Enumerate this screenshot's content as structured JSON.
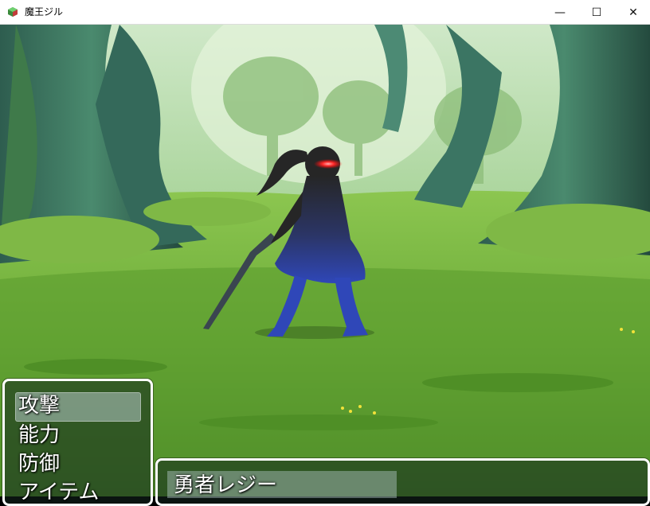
{
  "window": {
    "title": "魔王ジル",
    "minimize_symbol": "—",
    "maximize_symbol": "☐",
    "close_symbol": "✕"
  },
  "battle": {
    "enemy_icon": "shadow-swordswoman-sprite",
    "background": "forest-clearing"
  },
  "command_menu": {
    "items": [
      {
        "label": "攻撃",
        "selected": true
      },
      {
        "label": "能力",
        "selected": false
      },
      {
        "label": "防御",
        "selected": false
      },
      {
        "label": "アイテム",
        "selected": false
      }
    ]
  },
  "status_window": {
    "actor_name": "勇者レジー"
  },
  "colors": {
    "window_border": "#ffffff",
    "eye_glow": "#ff2a2a",
    "enemy_shadow_top": "#2a2a2a",
    "enemy_shadow_bottom": "#2f47b8"
  }
}
